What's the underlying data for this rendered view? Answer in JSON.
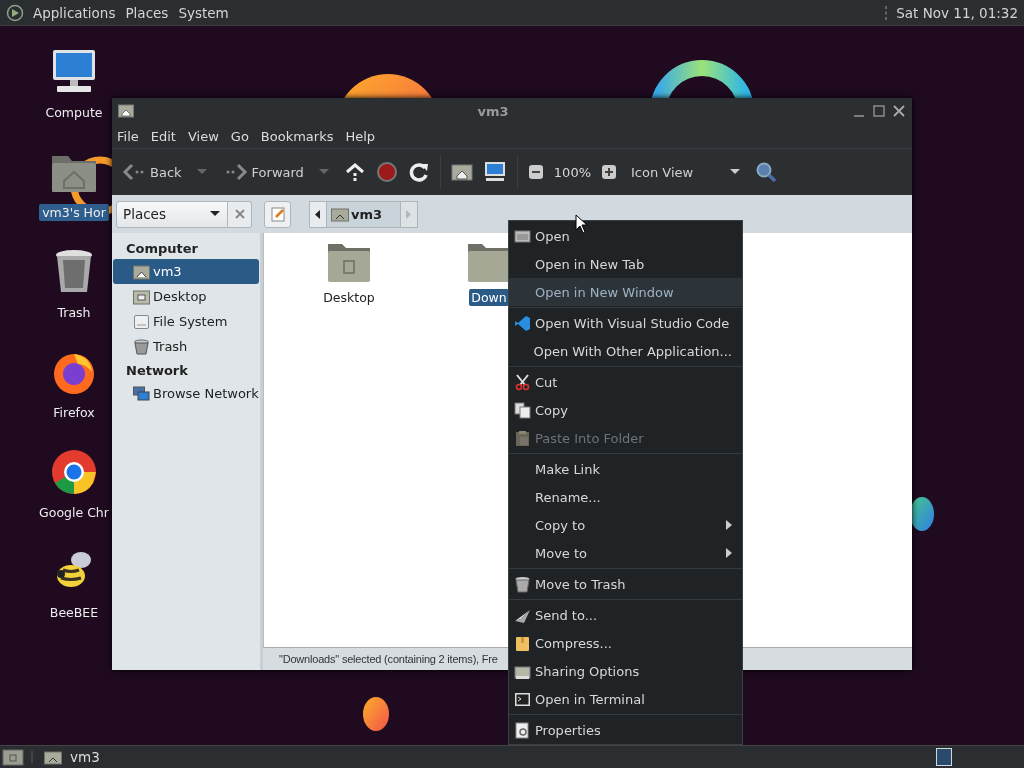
{
  "top_panel": {
    "menus": [
      "Applications",
      "Places",
      "System"
    ],
    "clock": "Sat Nov 11, 01:32"
  },
  "desktop_icons": [
    {
      "label": "Compute",
      "selected": false
    },
    {
      "label": "vm3's Hor",
      "selected": true
    },
    {
      "label": "Trash",
      "selected": false
    },
    {
      "label": "Firefox",
      "selected": false
    },
    {
      "label": "Google Chr",
      "selected": false
    },
    {
      "label": "BeeBEE",
      "selected": false
    }
  ],
  "window": {
    "title": "vm3",
    "menu": [
      "File",
      "Edit",
      "View",
      "Go",
      "Bookmarks",
      "Help"
    ],
    "toolbar": {
      "back": "Back",
      "forward": "Forward",
      "zoom": "100%",
      "view": "Icon View"
    },
    "location": {
      "places": "Places",
      "path": [
        {
          "label": "vm3",
          "selected": true
        }
      ]
    },
    "sidebar": [
      {
        "heading": "Computer",
        "items": [
          {
            "label": "vm3",
            "selected": true
          },
          {
            "label": "Desktop",
            "selected": false
          },
          {
            "label": "File System",
            "selected": false
          },
          {
            "label": "Trash",
            "selected": false
          }
        ]
      },
      {
        "heading": "Network",
        "items": [
          {
            "label": "Browse Network",
            "selected": false
          }
        ]
      }
    ],
    "files": [
      {
        "label": "Desktop",
        "selected": false
      },
      {
        "label": "Down",
        "selected": true
      }
    ],
    "status": "\"Downloads\" selected (containing 2 items), Fre"
  },
  "context_menu": [
    [
      {
        "label": "Open",
        "selected": false,
        "disabled": false,
        "submenu": false
      },
      {
        "label": "Open in New Tab",
        "selected": false,
        "disabled": false,
        "submenu": false
      },
      {
        "label": "Open in New Window",
        "selected": true,
        "disabled": false,
        "submenu": false
      }
    ],
    [
      {
        "label": "Open With Visual Studio Code",
        "selected": false,
        "disabled": false,
        "submenu": false
      },
      {
        "label": "Open With Other Application...",
        "selected": false,
        "disabled": false,
        "submenu": false
      }
    ],
    [
      {
        "label": "Cut",
        "selected": false,
        "disabled": false,
        "submenu": false
      },
      {
        "label": "Copy",
        "selected": false,
        "disabled": false,
        "submenu": false
      },
      {
        "label": "Paste Into Folder",
        "selected": false,
        "disabled": true,
        "submenu": false
      }
    ],
    [
      {
        "label": "Make Link",
        "selected": false,
        "disabled": false,
        "submenu": false
      },
      {
        "label": "Rename...",
        "selected": false,
        "disabled": false,
        "submenu": false
      },
      {
        "label": "Copy to",
        "selected": false,
        "disabled": false,
        "submenu": true
      },
      {
        "label": "Move to",
        "selected": false,
        "disabled": false,
        "submenu": true
      }
    ],
    [
      {
        "label": "Move to Trash",
        "selected": false,
        "disabled": false,
        "submenu": false
      }
    ],
    [
      {
        "label": "Send to...",
        "selected": false,
        "disabled": false,
        "submenu": false
      },
      {
        "label": "Compress...",
        "selected": false,
        "disabled": false,
        "submenu": false
      },
      {
        "label": "Sharing Options",
        "selected": false,
        "disabled": false,
        "submenu": false
      },
      {
        "label": "Open in Terminal",
        "selected": false,
        "disabled": false,
        "submenu": false
      }
    ],
    [
      {
        "label": "Properties",
        "selected": false,
        "disabled": false,
        "submenu": false
      }
    ]
  ],
  "taskbar": {
    "tasks": [
      {
        "label": "vm3"
      }
    ]
  }
}
